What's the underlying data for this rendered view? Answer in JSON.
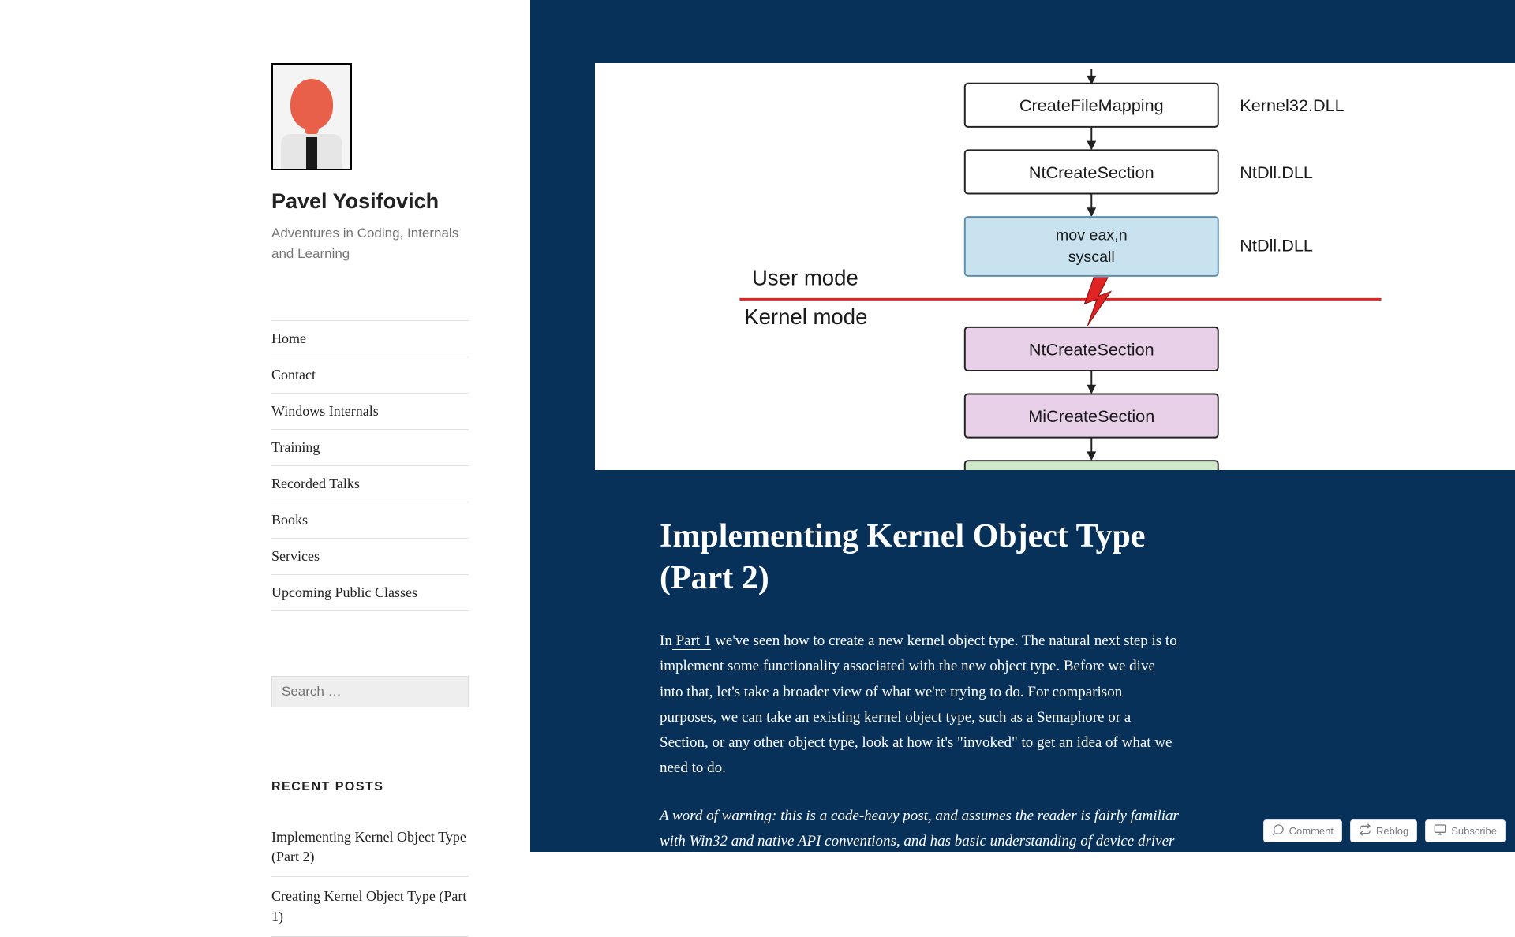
{
  "site": {
    "title": "Pavel Yosifovich",
    "tagline": "Adventures in Coding, Internals and Learning"
  },
  "nav": {
    "items": [
      {
        "label": "Home"
      },
      {
        "label": "Contact"
      },
      {
        "label": "Windows Internals"
      },
      {
        "label": "Training"
      },
      {
        "label": "Recorded Talks"
      },
      {
        "label": "Books"
      },
      {
        "label": "Services"
      },
      {
        "label": "Upcoming Public Classes"
      }
    ]
  },
  "search": {
    "placeholder": "Search …"
  },
  "recent": {
    "heading": "RECENT POSTS",
    "items": [
      {
        "label": "Implementing Kernel Object Type (Part 2)"
      },
      {
        "label": "Creating Kernel Object Type (Part 1)"
      }
    ]
  },
  "diagram": {
    "boxes": {
      "create_file_mapping": "CreateFileMapping",
      "nt_create_section_user": "NtCreateSection",
      "syscall_line1": "mov eax,n",
      "syscall_line2": "syscall",
      "nt_create_section_kernel": "NtCreateSection",
      "mi_create_section": "MiCreateSection"
    },
    "side_labels": {
      "kernel32": "Kernel32.DLL",
      "ntdll1": "NtDll.DLL",
      "ntdll2": "NtDll.DLL"
    },
    "modes": {
      "user": "User mode",
      "kernel": "Kernel mode"
    }
  },
  "article": {
    "title": "Implementing Kernel Object Type (Part 2)",
    "intro_prefix": "In",
    "intro_link": " Part 1",
    "intro_rest": " we've seen how to create a new kernel object type. The natural next step is to implement some functionality associated with the new object type. Before we dive into that, let's take a broader view of what we're trying to do. For comparison purposes, we can take an existing kernel object type, such as a Semaphore or a Section, or any other object type, look at how it's \"invoked\" to get an idea of what we need to do.",
    "warning": "A word of warning: this is a code-heavy post, and assumes the reader is fairly familiar with Win32 and native API conventions, and has basic understanding of device driver"
  },
  "footer": {
    "comment": "Comment",
    "reblog": "Reblog",
    "subscribe": "Subscribe"
  }
}
